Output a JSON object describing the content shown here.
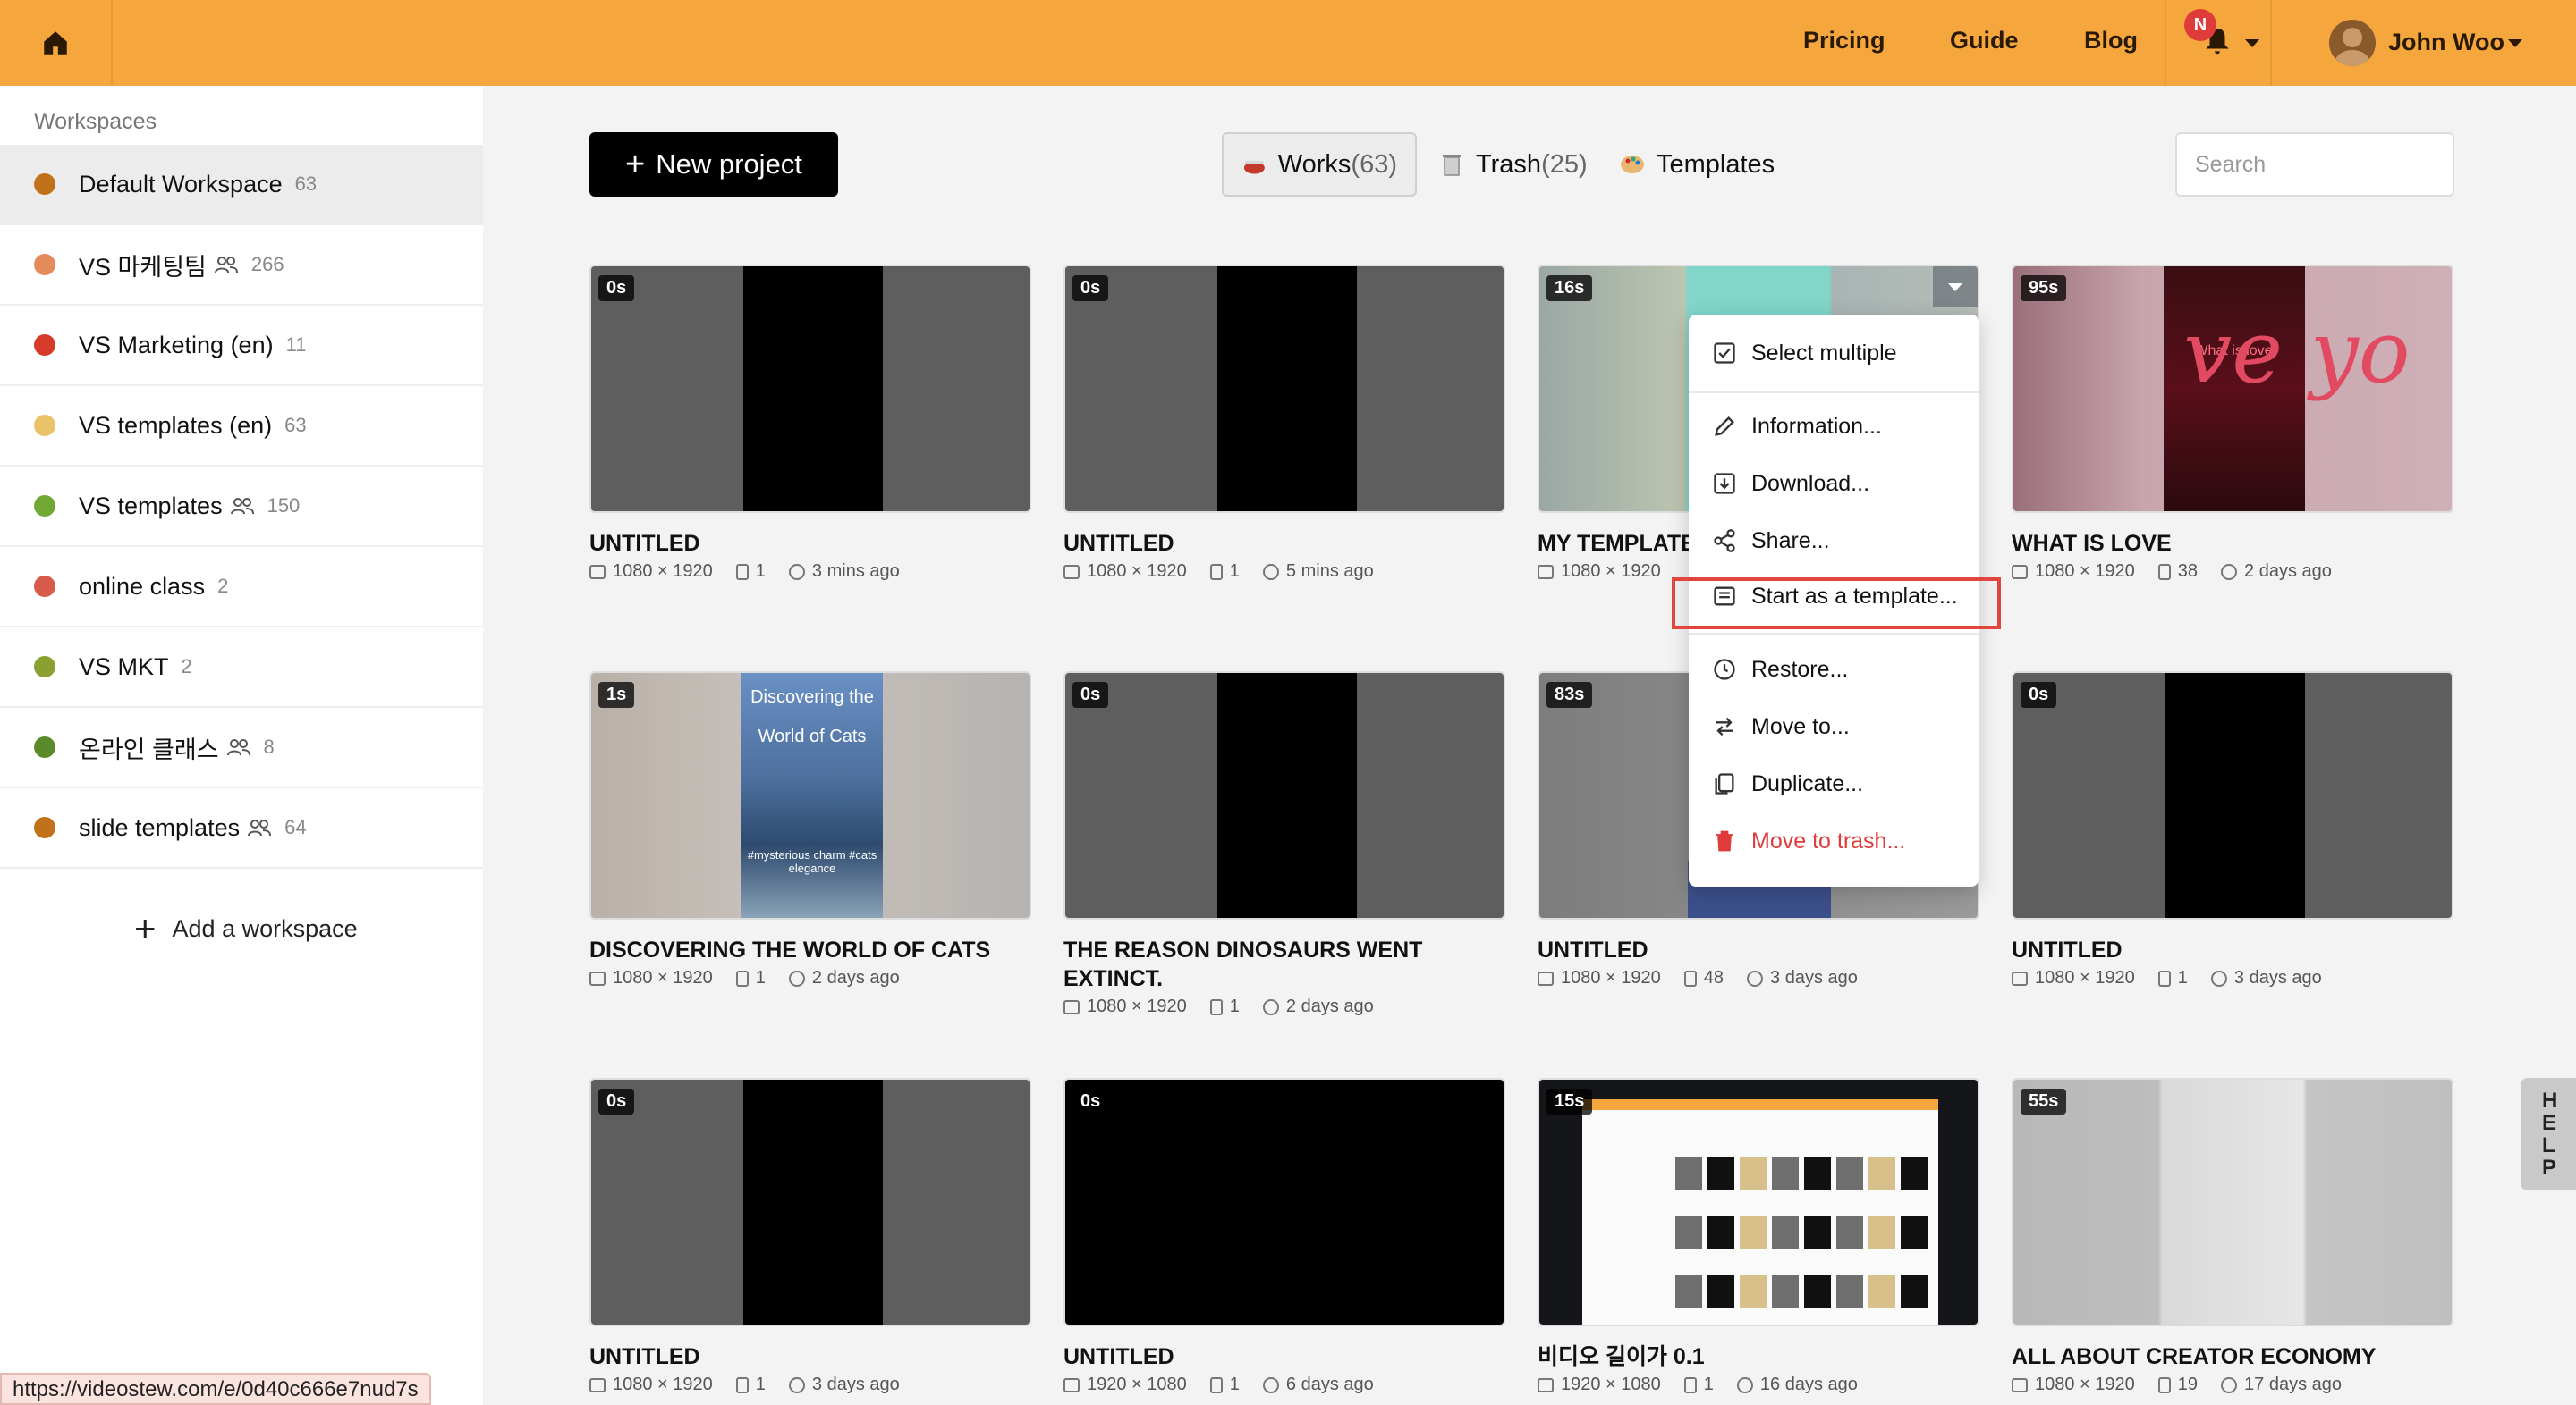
{
  "topbar": {
    "links": [
      "Pricing",
      "Guide",
      "Blog"
    ],
    "notification_badge": "N",
    "user_name": "John Woo",
    "brand_color": "#f5a63d"
  },
  "sidebar": {
    "heading": "Workspaces",
    "items": [
      {
        "name": "Default Workspace",
        "count": "63",
        "shared": false,
        "color": "#c0711a"
      },
      {
        "name": "VS 마케팅팀",
        "count": "266",
        "shared": true,
        "color": "#e58a5a"
      },
      {
        "name": "VS Marketing (en)",
        "count": "11",
        "shared": false,
        "color": "#d63b2a"
      },
      {
        "name": "VS templates (en)",
        "count": "63",
        "shared": false,
        "color": "#e9c26a"
      },
      {
        "name": "VS templates",
        "count": "150",
        "shared": true,
        "color": "#6fa832"
      },
      {
        "name": "online class",
        "count": "2",
        "shared": false,
        "color": "#d85a4a"
      },
      {
        "name": "VS MKT",
        "count": "2",
        "shared": false,
        "color": "#8aa030"
      },
      {
        "name": "온라인 클래스",
        "count": "8",
        "shared": true,
        "color": "#5b8a2a"
      },
      {
        "name": "slide templates",
        "count": "64",
        "shared": true,
        "color": "#c0711a"
      }
    ],
    "add_label": "Add a workspace"
  },
  "toolbar": {
    "new_project": "New project",
    "tabs": [
      {
        "label": "Works",
        "count": "(63)"
      },
      {
        "label": "Trash",
        "count": "(25)"
      },
      {
        "label": "Templates",
        "count": ""
      }
    ],
    "search_placeholder": "Search"
  },
  "cards": [
    {
      "duration": "0s",
      "title": "UNTITLED",
      "size": "1080 × 1920",
      "pages": "1",
      "time": "3 mins ago"
    },
    {
      "duration": "0s",
      "title": "UNTITLED",
      "size": "1080 × 1920",
      "pages": "1",
      "time": "5 mins ago"
    },
    {
      "duration": "16s",
      "title": "MY TEMPLATE",
      "size": "1080 × 1920",
      "pages": "",
      "time": ""
    },
    {
      "duration": "95s",
      "title": "WHAT IS LOVE",
      "size": "1080 × 1920",
      "pages": "38",
      "time": "2 days ago"
    },
    {
      "duration": "1s",
      "title": "DISCOVERING THE WORLD OF CATS",
      "size": "1080 × 1920",
      "pages": "1",
      "time": "2 days ago"
    },
    {
      "duration": "0s",
      "title": "THE REASON DINOSAURS WENT EXTINCT.",
      "size": "1080 × 1920",
      "pages": "1",
      "time": "2 days ago"
    },
    {
      "duration": "83s",
      "title": "UNTITLED",
      "size": "1080 × 1920",
      "pages": "48",
      "time": "3 days ago"
    },
    {
      "duration": "0s",
      "title": "UNTITLED",
      "size": "1080 × 1920",
      "pages": "1",
      "time": "3 days ago"
    },
    {
      "duration": "0s",
      "title": "UNTITLED",
      "size": "1080 × 1920",
      "pages": "1",
      "time": "3 days ago"
    },
    {
      "duration": "0s",
      "title": "UNTITLED",
      "size": "1920 × 1080",
      "pages": "1",
      "time": "6 days ago"
    },
    {
      "duration": "15s",
      "title": "비디오 길이가 0.1",
      "size": "1920 × 1080",
      "pages": "1",
      "time": "16 days ago"
    },
    {
      "duration": "55s",
      "title": "ALL ABOUT CREATOR ECONOMY",
      "size": "1080 × 1920",
      "pages": "19",
      "time": "17 days ago"
    }
  ],
  "thumb_text": {
    "cats_line1": "Discovering the",
    "cats_line2": "World of Cats",
    "cats_tags": "#mysterious charm #cats elegance",
    "love_text": "ve yo",
    "love_top": "What is love"
  },
  "context_menu": {
    "items": [
      {
        "label": "Select multiple",
        "icon": "checkbox-icon"
      },
      {
        "label": "Information...",
        "icon": "pencil-icon"
      },
      {
        "label": "Download...",
        "icon": "download-icon"
      },
      {
        "label": "Share...",
        "icon": "share-icon"
      },
      {
        "label": "Start as a template...",
        "icon": "template-icon"
      },
      {
        "label": "Restore...",
        "icon": "history-icon"
      },
      {
        "label": "Move to...",
        "icon": "arrows-icon"
      },
      {
        "label": "Duplicate...",
        "icon": "duplicate-icon"
      },
      {
        "label": "Move to trash...",
        "icon": "trash-icon",
        "danger": true
      }
    ]
  },
  "help_label": "HELP",
  "status_url": "https://videostew.com/e/0d40c666e7nud7s"
}
